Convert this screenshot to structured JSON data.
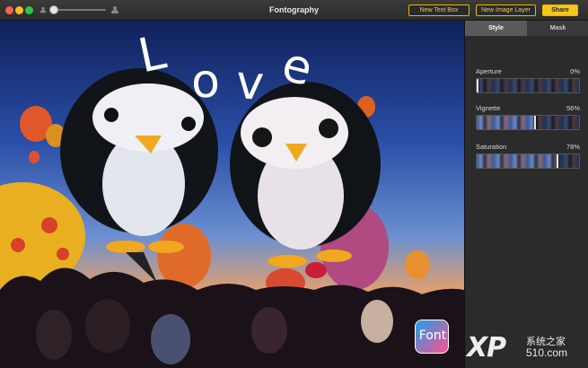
{
  "window": {
    "title": "Fontography"
  },
  "toolbar": {
    "new_text_box": "New Text Box",
    "new_image_layer": "New Image Layer",
    "share": "Share",
    "accent": "#f5c518"
  },
  "canvas": {
    "text_overlay": "Love",
    "text_overlay_letters": [
      "L",
      "o",
      "v",
      "e"
    ]
  },
  "inspector": {
    "tabs": [
      {
        "label": "Style",
        "active": true
      },
      {
        "label": "Mask",
        "active": false
      }
    ],
    "controls": [
      {
        "label": "Aperture",
        "value": "0%",
        "level": 0.0
      },
      {
        "label": "Vignette",
        "value": "56%",
        "level": 0.56
      },
      {
        "label": "Saturation",
        "value": "78%",
        "level": 0.78
      }
    ]
  },
  "badges": {
    "app_icon_text": "Font",
    "watermark_xp": "XP",
    "watermark_cn": "系统之家",
    "watermark_site": "510.com"
  }
}
